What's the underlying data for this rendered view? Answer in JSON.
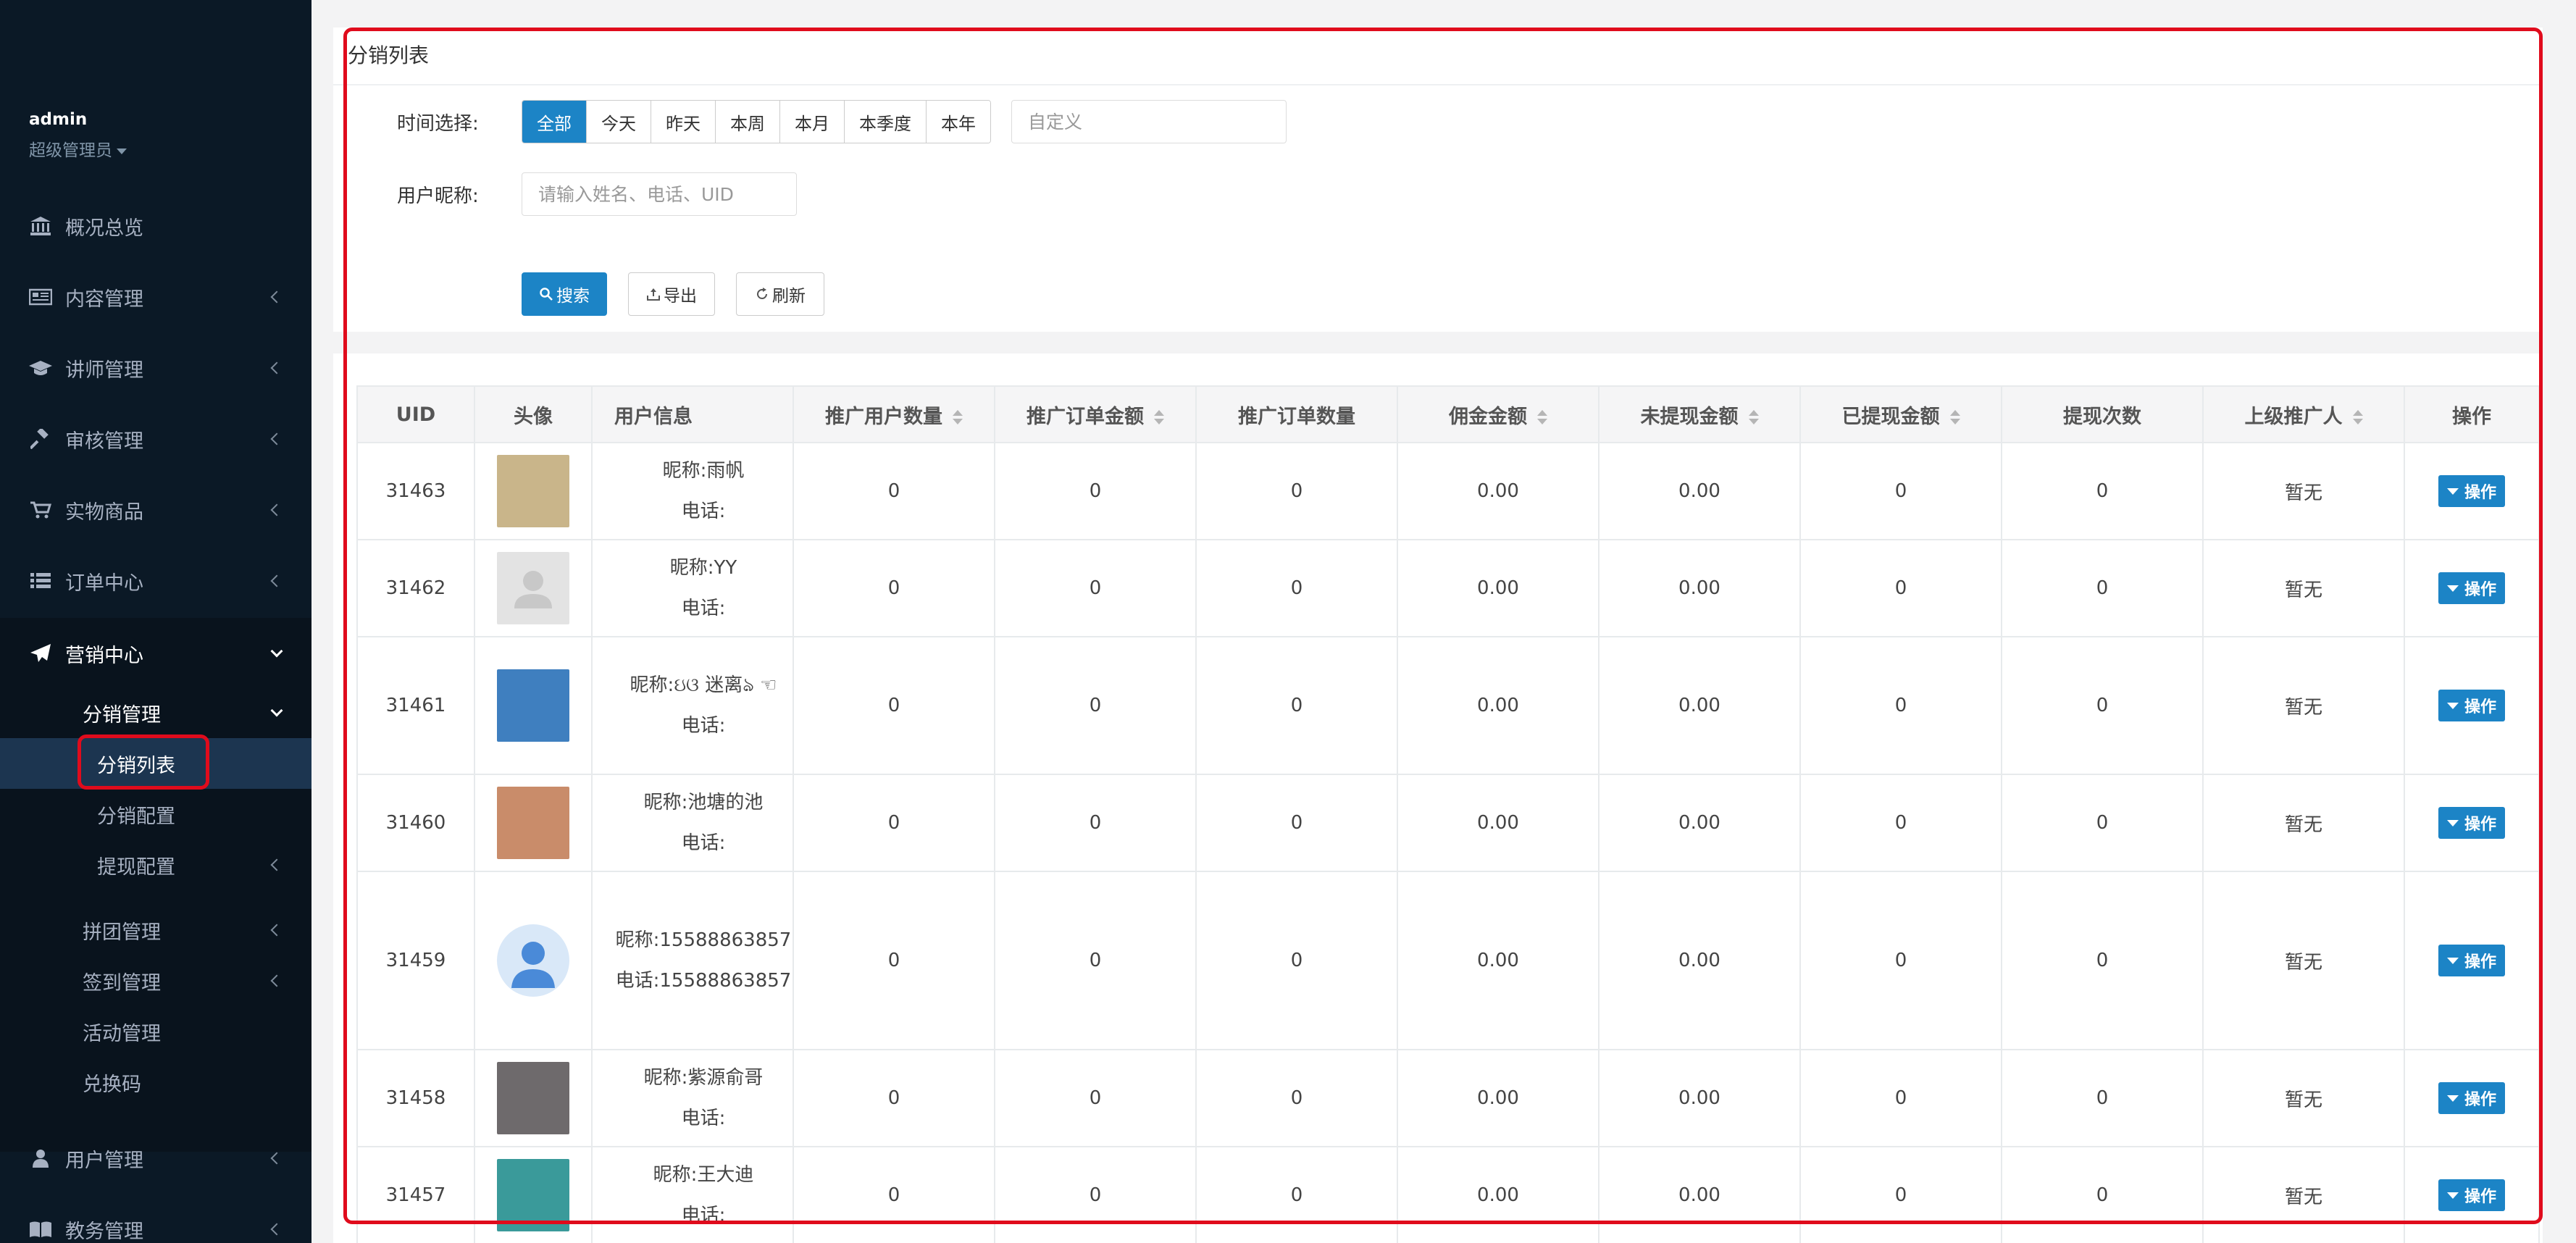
{
  "sidebar": {
    "profile": {
      "name": "admin",
      "role": "超级管理员"
    },
    "nav": [
      {
        "label": "概况总览",
        "icon": "bank-icon"
      },
      {
        "label": "内容管理",
        "icon": "newspaper-icon"
      },
      {
        "label": "讲师管理",
        "icon": "graduation-cap-icon"
      },
      {
        "label": "审核管理",
        "icon": "gavel-icon"
      },
      {
        "label": "实物商品",
        "icon": "cart-icon"
      },
      {
        "label": "订单中心",
        "icon": "list-icon"
      },
      {
        "label": "营销中心",
        "icon": "paper-plane-icon"
      },
      {
        "label": "用户管理",
        "icon": "user-icon"
      },
      {
        "label": "教务管理",
        "icon": "book-icon"
      }
    ],
    "sub": {
      "distribution": "分销管理",
      "distribution_list": "分销列表",
      "distribution_config": "分销配置",
      "withdraw_config": "提现配置",
      "group_buy": "拼团管理",
      "checkin": "签到管理",
      "activity": "活动管理",
      "redeem": "兑换码"
    }
  },
  "page": {
    "title": "分销列表",
    "time_label": "时间选择:",
    "time_options": [
      "全部",
      "今天",
      "昨天",
      "本周",
      "本月",
      "本季度",
      "本年"
    ],
    "custom_placeholder": "自定义",
    "nickname_label": "用户昵称:",
    "nickname_placeholder": "请输入姓名、电话、UID",
    "search_label": "搜索",
    "export_label": "导出",
    "refresh_label": "刷新"
  },
  "table": {
    "headers": [
      "UID",
      "头像",
      "用户信息",
      "推广用户数量",
      "推广订单金额",
      "推广订单数量",
      "佣金金额",
      "未提现金额",
      "已提现金额",
      "提现次数",
      "上级推广人",
      "操作"
    ],
    "nick_prefix": "昵称:",
    "phone_prefix": "电话:",
    "op_label": "操作",
    "rows": [
      {
        "uid": "31463",
        "nick": "雨帆",
        "phone": "",
        "promo_users": "0",
        "order_amount": "0",
        "order_count": "0",
        "commission": "0.00",
        "unwithdrawn": "0.00",
        "withdrawn": "0",
        "withdraw_times": "0",
        "superior": "暂无",
        "avatar_color": "#c9b58a"
      },
      {
        "uid": "31462",
        "nick": "YY",
        "phone": "",
        "promo_users": "0",
        "order_amount": "0",
        "order_count": "0",
        "commission": "0.00",
        "unwithdrawn": "0.00",
        "withdrawn": "0",
        "withdraw_times": "0",
        "superior": "暂无",
        "avatar_color": "#e3e3e3"
      },
      {
        "uid": "31461",
        "nick": "ઇଓ 迷离ঌ ☜",
        "phone": "",
        "promo_users": "0",
        "order_amount": "0",
        "order_count": "0",
        "commission": "0.00",
        "unwithdrawn": "0.00",
        "withdrawn": "0",
        "withdraw_times": "0",
        "superior": "暂无",
        "avatar_color": "#3f7fbf"
      },
      {
        "uid": "31460",
        "nick": "池塘的池",
        "phone": "",
        "promo_users": "0",
        "order_amount": "0",
        "order_count": "0",
        "commission": "0.00",
        "unwithdrawn": "0.00",
        "withdrawn": "0",
        "withdraw_times": "0",
        "superior": "暂无",
        "avatar_color": "#c98c6a"
      },
      {
        "uid": "31459",
        "nick": "15588863857",
        "phone": "15588863857",
        "promo_users": "0",
        "order_amount": "0",
        "order_count": "0",
        "commission": "0.00",
        "unwithdrawn": "0.00",
        "withdrawn": "0",
        "withdraw_times": "0",
        "superior": "暂无",
        "avatar_color": "#d9e8f8"
      },
      {
        "uid": "31458",
        "nick": "紫源俞哥",
        "phone": "",
        "promo_users": "0",
        "order_amount": "0",
        "order_count": "0",
        "commission": "0.00",
        "unwithdrawn": "0.00",
        "withdrawn": "0",
        "withdraw_times": "0",
        "superior": "暂无",
        "avatar_color": "#6e6a6c"
      },
      {
        "uid": "31457",
        "nick": "王大迪",
        "phone": "",
        "promo_users": "0",
        "order_amount": "0",
        "order_count": "0",
        "commission": "0.00",
        "unwithdrawn": "0.00",
        "withdrawn": "0",
        "withdraw_times": "0",
        "superior": "暂无",
        "avatar_color": "#3a9a9a"
      }
    ]
  }
}
